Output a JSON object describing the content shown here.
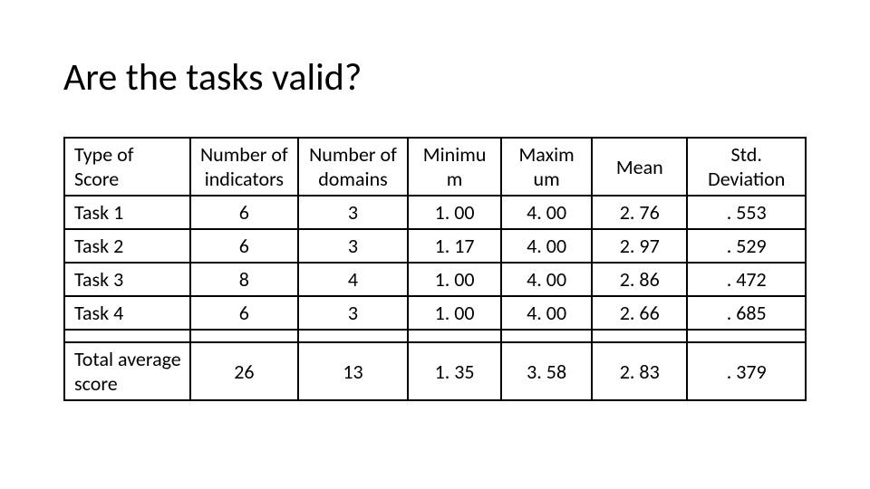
{
  "title": "Are the tasks valid?",
  "headers": {
    "type": "Type of Score",
    "indicators": "Number of indicators",
    "domains": "Number of domains",
    "min": "Minimu m",
    "max": "Maxim um",
    "mean": "Mean",
    "std": "Std. Deviation"
  },
  "rows": [
    {
      "label": "Task 1",
      "ind": "6",
      "dom": "3",
      "min": "1. 00",
      "max": "4. 00",
      "mean": "2. 76",
      "std": ". 553"
    },
    {
      "label": "Task 2",
      "ind": "6",
      "dom": "3",
      "min": "1. 17",
      "max": "4. 00",
      "mean": "2. 97",
      "std": ". 529"
    },
    {
      "label": "Task 3",
      "ind": "8",
      "dom": "4",
      "min": "1. 00",
      "max": "4. 00",
      "mean": "2. 86",
      "std": ". 472"
    },
    {
      "label": "Task 4",
      "ind": "6",
      "dom": "3",
      "min": "1. 00",
      "max": "4. 00",
      "mean": "2. 66",
      "std": ". 685"
    }
  ],
  "total": {
    "label": "Total average score",
    "ind": "26",
    "dom": "13",
    "min": "1. 35",
    "max": "3. 58",
    "mean": "2. 83",
    "std": ". 379"
  },
  "chart_data": {
    "type": "table",
    "title": "Are the tasks valid?",
    "columns": [
      "Type of Score",
      "Number of indicators",
      "Number of domains",
      "Minimum",
      "Maximum",
      "Mean",
      "Std. Deviation"
    ],
    "rows": [
      [
        "Task 1",
        6,
        3,
        1.0,
        4.0,
        2.76,
        0.553
      ],
      [
        "Task 2",
        6,
        3,
        1.17,
        4.0,
        2.97,
        0.529
      ],
      [
        "Task 3",
        8,
        4,
        1.0,
        4.0,
        2.86,
        0.472
      ],
      [
        "Task 4",
        6,
        3,
        1.0,
        4.0,
        2.66,
        0.685
      ],
      [
        "Total average score",
        26,
        13,
        1.35,
        3.58,
        2.83,
        0.379
      ]
    ]
  }
}
